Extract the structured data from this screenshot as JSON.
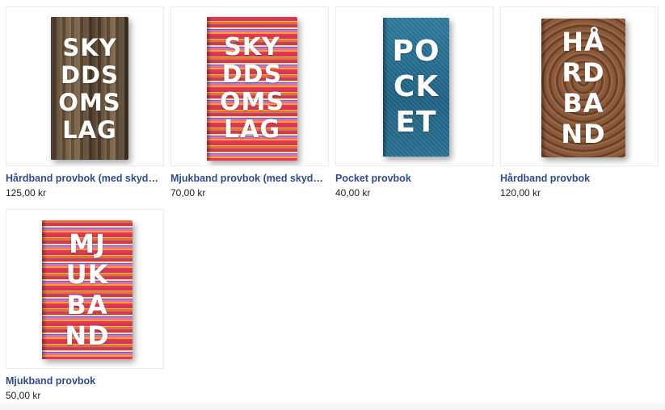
{
  "products": [
    {
      "name": "Hårdband provbok (med skyddsomslag)",
      "price": "125,00 kr",
      "cover_text": [
        "SKY",
        "DDS",
        "OMS",
        "LAG"
      ],
      "cover_style": "wood"
    },
    {
      "name": "Mjukband provbok (med skyddsomslag)",
      "price": "70,00 kr",
      "cover_text": [
        "SKY",
        "DDS",
        "OMS",
        "LAG"
      ],
      "cover_style": "rug"
    },
    {
      "name": "Pocket provbok",
      "price": "40,00 kr",
      "cover_text": [
        "PO",
        "CK",
        "ET"
      ],
      "cover_style": "denim"
    },
    {
      "name": "Hårdband provbok",
      "price": "120,00 kr",
      "cover_text": [
        "HÅ",
        "RD",
        "BA",
        "ND"
      ],
      "cover_style": "stump"
    },
    {
      "name": "Mjukband provbok",
      "price": "50,00 kr",
      "cover_text": [
        "MJ",
        "UK",
        "BA",
        "ND"
      ],
      "cover_style": "rug"
    }
  ],
  "colors": {
    "link": "#2f4b8f",
    "price": "#222222"
  }
}
